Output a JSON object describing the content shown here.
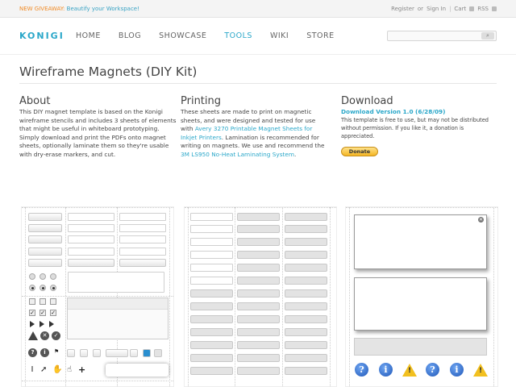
{
  "topbar": {
    "promo_tag": "NEW GIVEAWAY:",
    "promo_text": "Beautify your Workspace!",
    "register": "Register",
    "or": "or",
    "signin": "Sign In",
    "cart": "Cart",
    "rss": "RSS"
  },
  "nav": {
    "logo": "KONIGI",
    "links": [
      "HOME",
      "BLOG",
      "SHOWCASE",
      "TOOLS",
      "WIKI",
      "STORE"
    ],
    "active": "TOOLS"
  },
  "page": {
    "title": "Wireframe Magnets (DIY Kit)"
  },
  "about": {
    "heading": "About",
    "text": "This DIY magnet template is based on the Konigi wireframe stencils and includes 3 sheets of elements that might be useful in whiteboard prototyping. Simply download and print the PDFs onto magnet sheets, optionally laminate them so they're usable with dry-erase markers, and cut."
  },
  "printing": {
    "heading": "Printing",
    "text_before": "These sheets are made to print on magnetic sheets, and were designed and tested for use with",
    "link1": "Avery 3270 Printable Magnet Sheets for Inkjet Printers",
    "text_middle": ". Lamination is recommended for writing on magnets. We use and recommend the",
    "link2": "3M LS950 No-Heat Laminating System",
    "text_after": "."
  },
  "download": {
    "heading": "Download",
    "link": "Download Version 1.0 (6/28/09)",
    "text": "This template is free to use, but may not be distributed without permission. If you like it, a donation is appreciated.",
    "donate_label": "Donate"
  },
  "colors": {
    "accent": "#2aa7c9",
    "promo": "#f08a24"
  }
}
